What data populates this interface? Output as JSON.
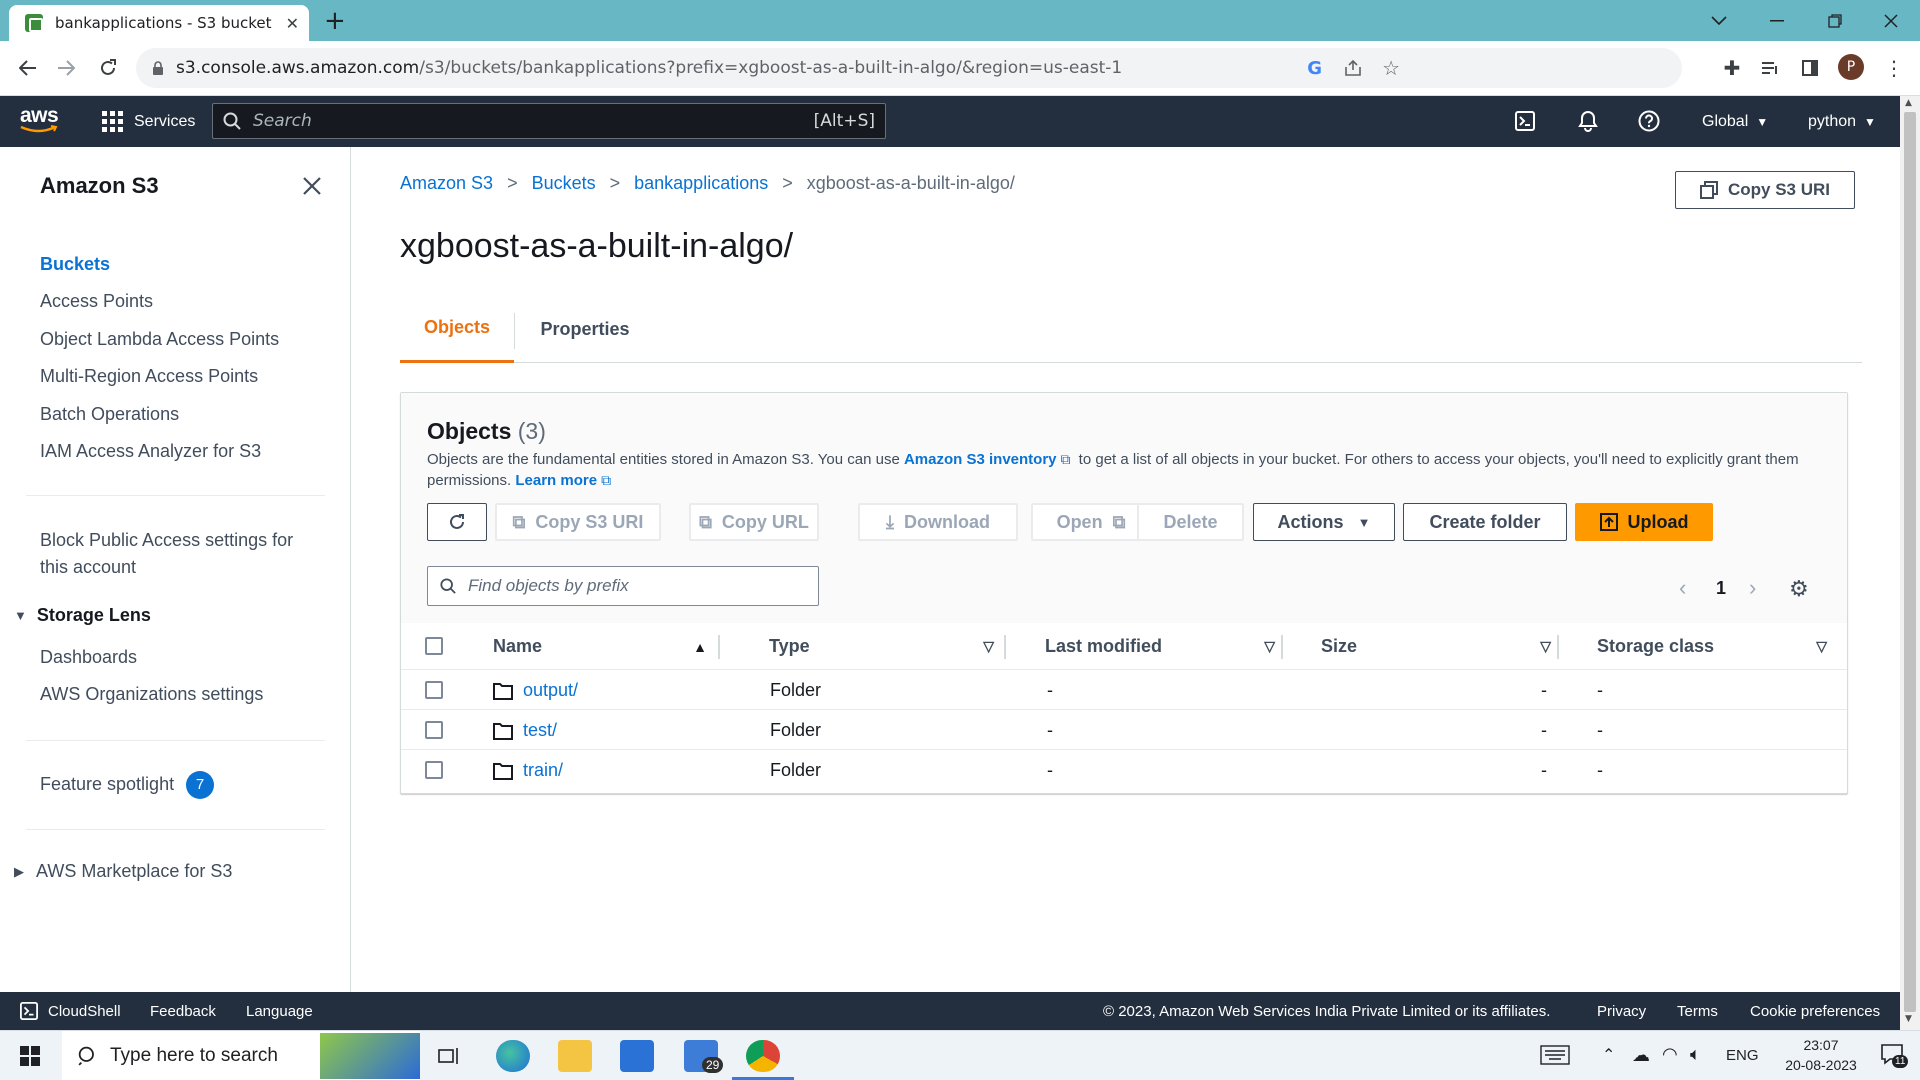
{
  "browser": {
    "tab_title": "bankapplications - S3 bucket",
    "url_host": "s3.console.aws.amazon.com",
    "url_path": "/s3/buckets/bankapplications?prefix=xgboost-as-a-built-in-algo/&region=us-east-1",
    "profile_initial": "P"
  },
  "aws_header": {
    "services_label": "Services",
    "search_placeholder": "Search",
    "search_shortcut": "[Alt+S]",
    "region_label": "Global",
    "account_label": "python"
  },
  "sidebar": {
    "title": "Amazon S3",
    "items": [
      {
        "label": "Buckets",
        "active": true
      },
      {
        "label": "Access Points"
      },
      {
        "label": "Object Lambda Access Points"
      },
      {
        "label": "Multi-Region Access Points"
      },
      {
        "label": "Batch Operations"
      },
      {
        "label": "IAM Access Analyzer for S3"
      }
    ],
    "block_public_line1": "Block Public Access settings for",
    "block_public_line2": "this account",
    "storage_lens_label": "Storage Lens",
    "storage_lens_items": [
      "Dashboards",
      "AWS Organizations settings"
    ],
    "feature_spotlight_label": "Feature spotlight",
    "feature_spotlight_count": "7",
    "marketplace_label": "AWS Marketplace for S3"
  },
  "breadcrumb": [
    "Amazon S3",
    "Buckets",
    "bankapplications",
    "xgboost-as-a-built-in-algo/"
  ],
  "page": {
    "title": "xgboost-as-a-built-in-algo/",
    "copy_s3_uri_label": "Copy S3 URI",
    "tabs": [
      {
        "label": "Objects",
        "active": true
      },
      {
        "label": "Properties"
      }
    ]
  },
  "objects": {
    "title": "Objects",
    "count": "(3)",
    "desc_part1": "Objects are the fundamental entities stored in Amazon S3. You can use ",
    "desc_link1": "Amazon S3 inventory",
    "desc_part2": " to get a list of all objects in your bucket. For others to access your objects, you'll need to explicitly grant them permissions. ",
    "desc_link2": "Learn more",
    "buttons": {
      "copy_s3_uri": "Copy S3 URI",
      "copy_url": "Copy URL",
      "download": "Download",
      "open": "Open",
      "delete": "Delete",
      "actions": "Actions",
      "create_folder": "Create folder",
      "upload": "Upload"
    },
    "filter_placeholder": "Find objects by prefix",
    "page_number": "1",
    "columns": [
      "Name",
      "Type",
      "Last modified",
      "Size",
      "Storage class"
    ],
    "rows": [
      {
        "name": "output/",
        "type": "Folder",
        "last_modified": "-",
        "size": "-",
        "storage_class": "-"
      },
      {
        "name": "test/",
        "type": "Folder",
        "last_modified": "-",
        "size": "-",
        "storage_class": "-"
      },
      {
        "name": "train/",
        "type": "Folder",
        "last_modified": "-",
        "size": "-",
        "storage_class": "-"
      }
    ]
  },
  "footer": {
    "cloudshell": "CloudShell",
    "feedback": "Feedback",
    "language": "Language",
    "copyright": "© 2023, Amazon Web Services India Private Limited or its affiliates.",
    "privacy": "Privacy",
    "terms": "Terms",
    "cookie": "Cookie preferences"
  },
  "taskbar": {
    "search_placeholder": "Type here to search",
    "mail_badge": "29",
    "lang": "ENG",
    "time": "23:07",
    "date": "20-08-2023",
    "notif_count": "11"
  },
  "colors": {
    "aws_header": "#232f3e",
    "link_blue": "#0972d3",
    "tab_active_orange": "#ec7211",
    "primary_button": "#ff9900",
    "browser_frame": "#67b8c4"
  }
}
